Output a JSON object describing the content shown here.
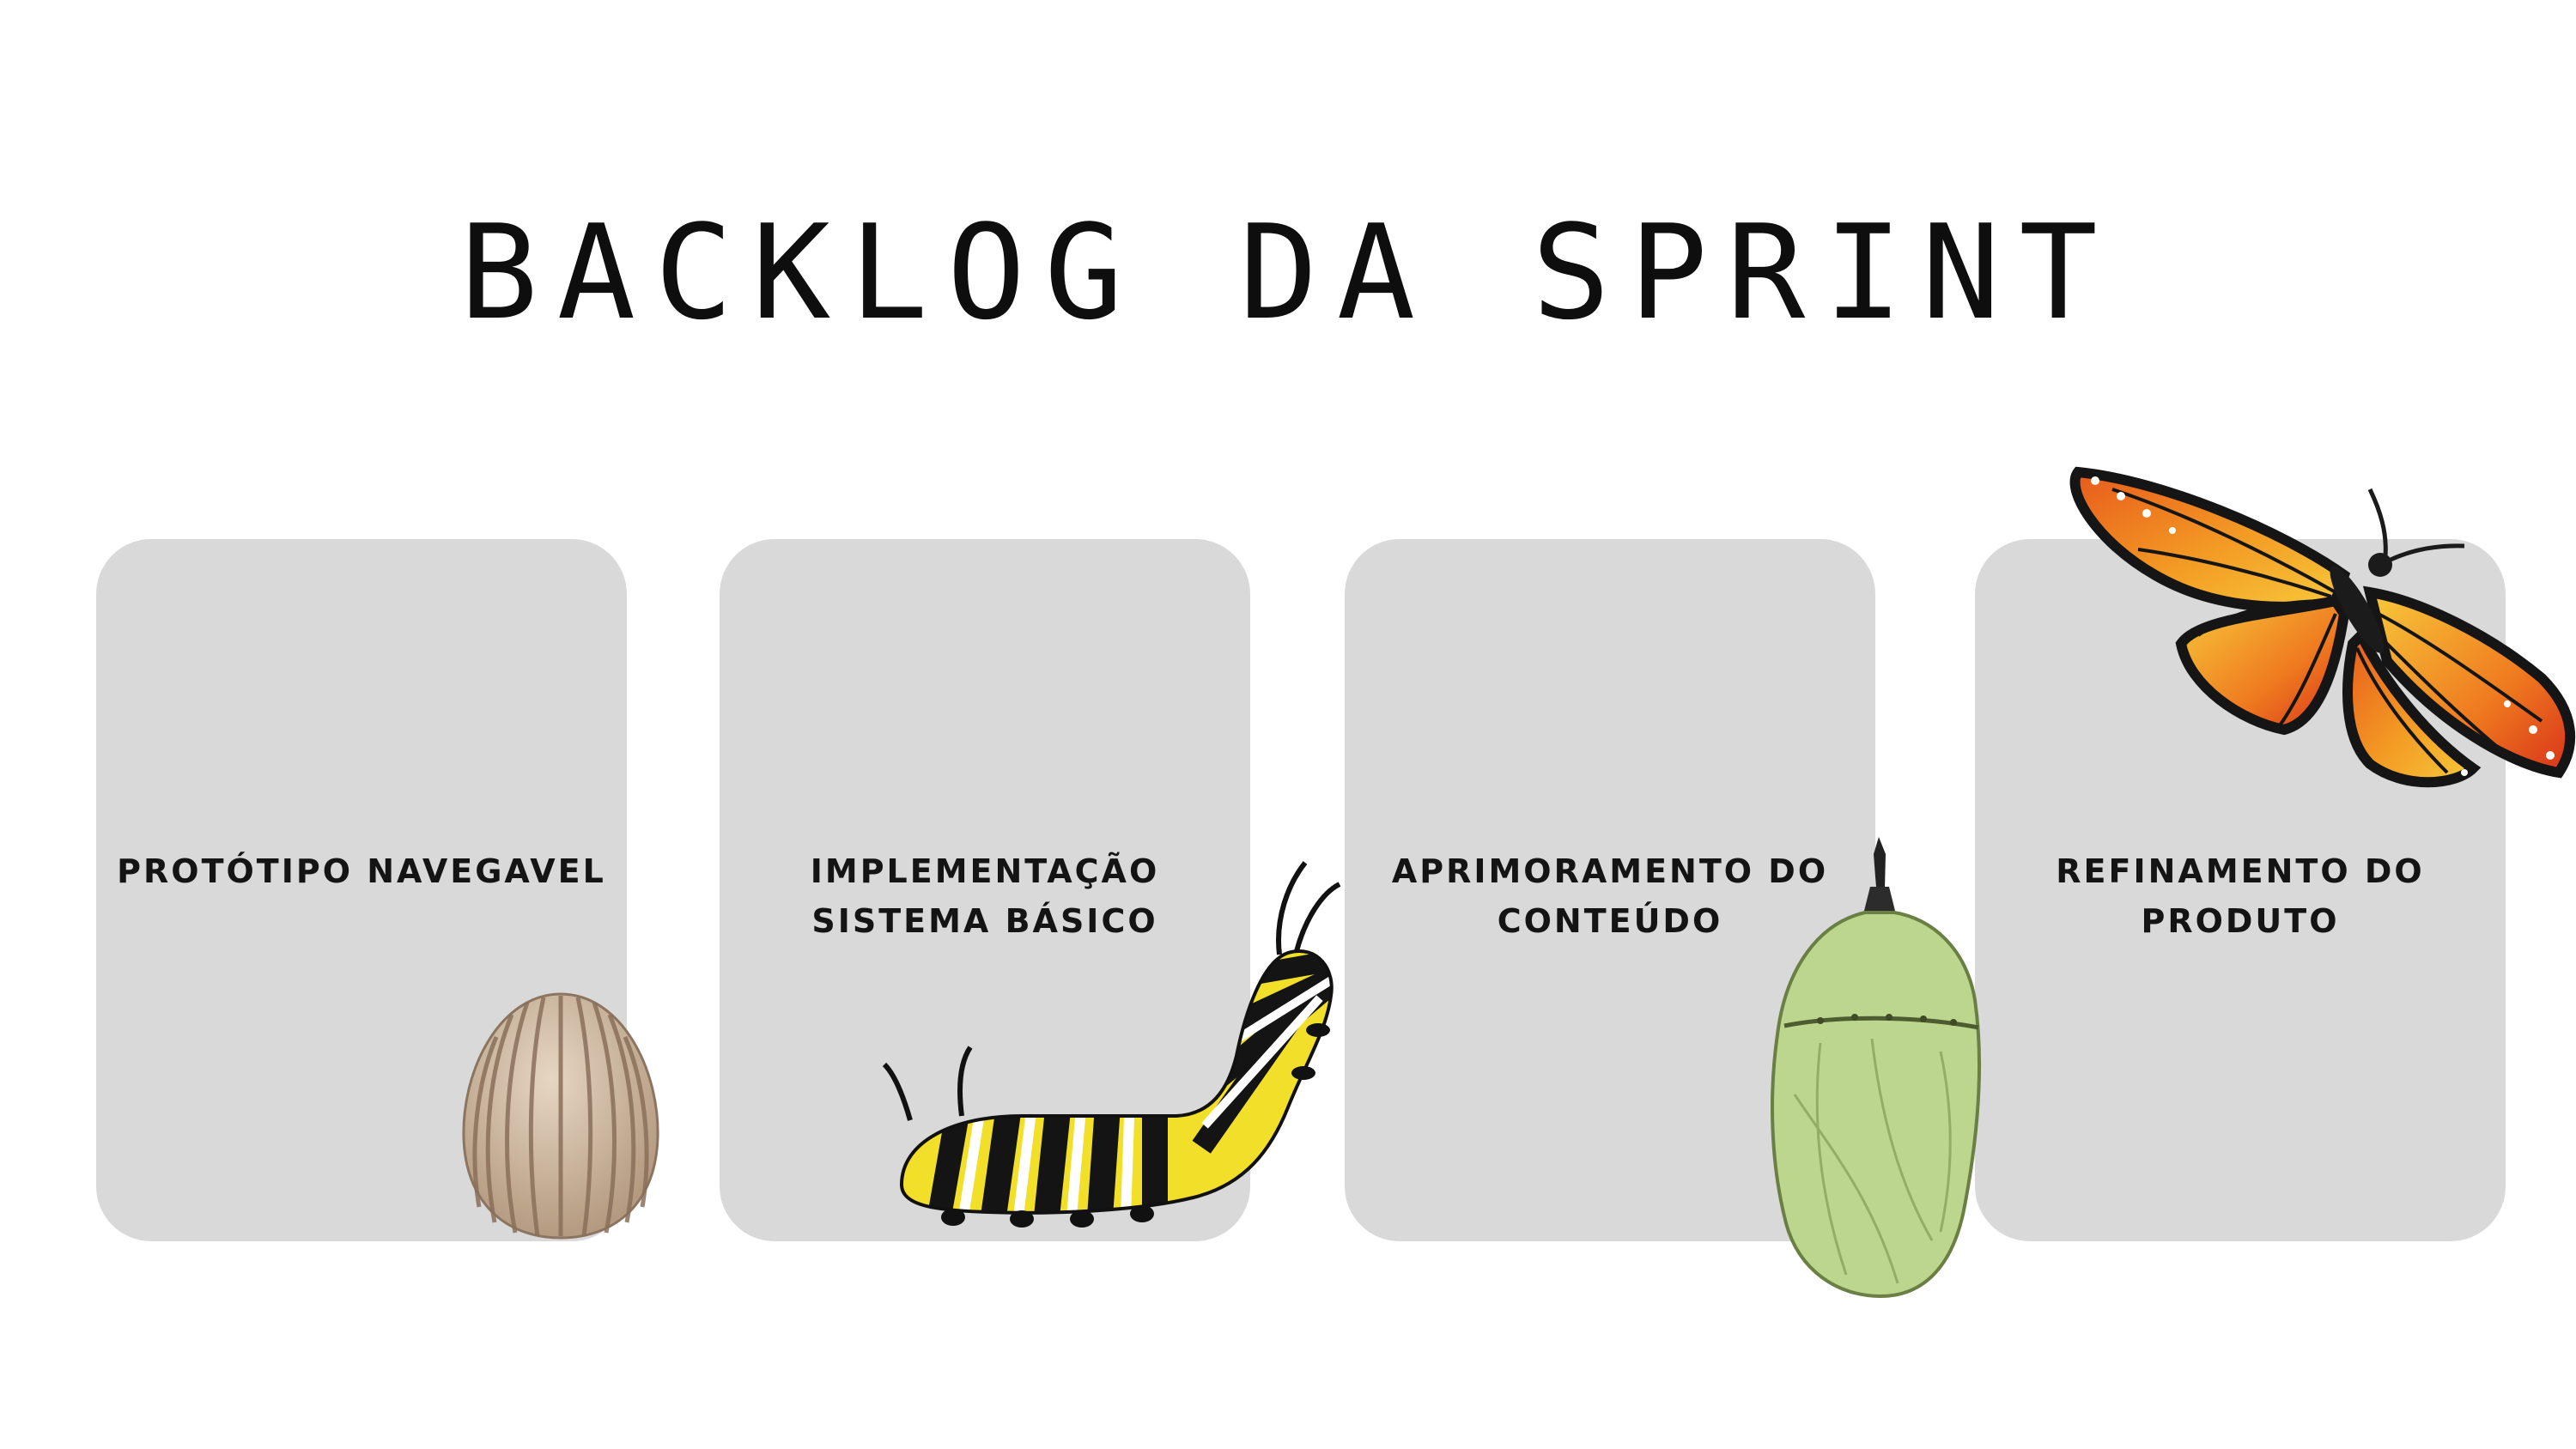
{
  "page": {
    "title": "BACKLOG DA SPRINT"
  },
  "cards": [
    {
      "label": "PROTÓTIPO NAVEGAVEL",
      "illustration": "egg-illustration"
    },
    {
      "label": "IMPLEMENTAÇÃO\nSISTEMA BÁSICO",
      "illustration": "caterpillar-illustration"
    },
    {
      "label": "APRIMORAMENTO DO\nCONTEÚDO",
      "illustration": "chrysalis-illustration"
    },
    {
      "label": "REFINAMENTO DO\nPRODUTO",
      "illustration": "butterfly-illustration"
    }
  ],
  "colors": {
    "background": "#ffffff",
    "card": "#d9d9d9",
    "text": "#141414",
    "egg": "#cdb9a1",
    "caterpillar_yellow": "#f2df2a",
    "chrysalis_green": "#bcd68e",
    "butterfly_orange": "#ef7a1f"
  }
}
